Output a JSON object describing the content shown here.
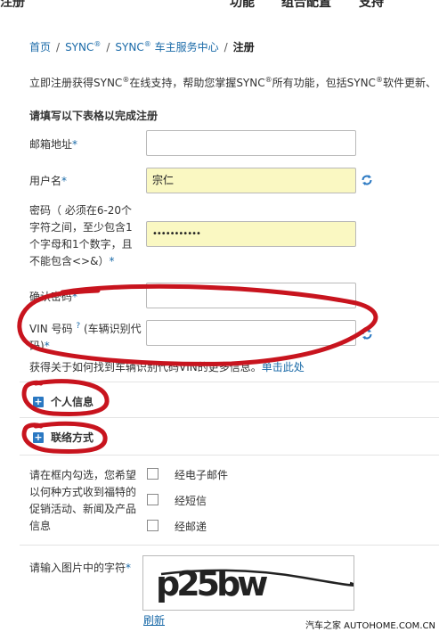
{
  "top_nav": {
    "left": "注册",
    "item1": "功能",
    "item2": "组合配置",
    "item3": "支持"
  },
  "breadcrumb": {
    "home": "首页",
    "sync": "SYNC",
    "sync_center": "SYNC",
    "sync_center_suffix": "车主服务中心",
    "current": "注册",
    "reg_mark": "®"
  },
  "intro": {
    "part1": "立即注册获得SYNC",
    "part2": "在线支持，帮助您掌握SYNC",
    "part3": "所有功能，包括SYNC",
    "part4": "软件更新、",
    "reg_mark": "®"
  },
  "form": {
    "section_title": "请填写以下表格以完成注册",
    "required_mark": "*",
    "email": {
      "label": "邮箱地址",
      "value": ""
    },
    "username": {
      "label": "用户名",
      "value": "宗仁"
    },
    "password": {
      "label_lines": [
        "密码（ 必须在6-20个",
        "字符之间，至少包含1",
        "个字母和1个数字，且",
        "不能包含<>&）"
      ],
      "masked_value": "•••••••••••"
    },
    "confirm_password": {
      "label": "确认密码",
      "value": ""
    },
    "vin": {
      "label_prefix": "VIN 号码",
      "help_mark": "?",
      "label_suffix": "(车辆识别代",
      "label_line2": "码)",
      "value": ""
    },
    "vin_hint": {
      "text": "获得关于如何找到车辆识别代码VIN的更多信息。",
      "link": "单击此处"
    },
    "personal_info": "个人信息",
    "contact_info": "联络方式",
    "contact_pref": {
      "label_lines": [
        "请在框内勾选，您希望",
        "以何种方式收到福特的",
        "促销活动、新闻及产品",
        "信息"
      ],
      "options": [
        "经电子邮件",
        "经短信",
        "经邮递"
      ]
    },
    "captcha": {
      "label": "请输入图片中的字符",
      "image_text": "p25bw",
      "refresh": "刷新"
    }
  },
  "watermark": "汽车之家 AUTOHOME.COM.CN",
  "colors": {
    "link": "#1a6aa8",
    "filled_input": "#faf8c2",
    "annotation": "#c8141e",
    "plus_icon": "#2a78c2"
  }
}
